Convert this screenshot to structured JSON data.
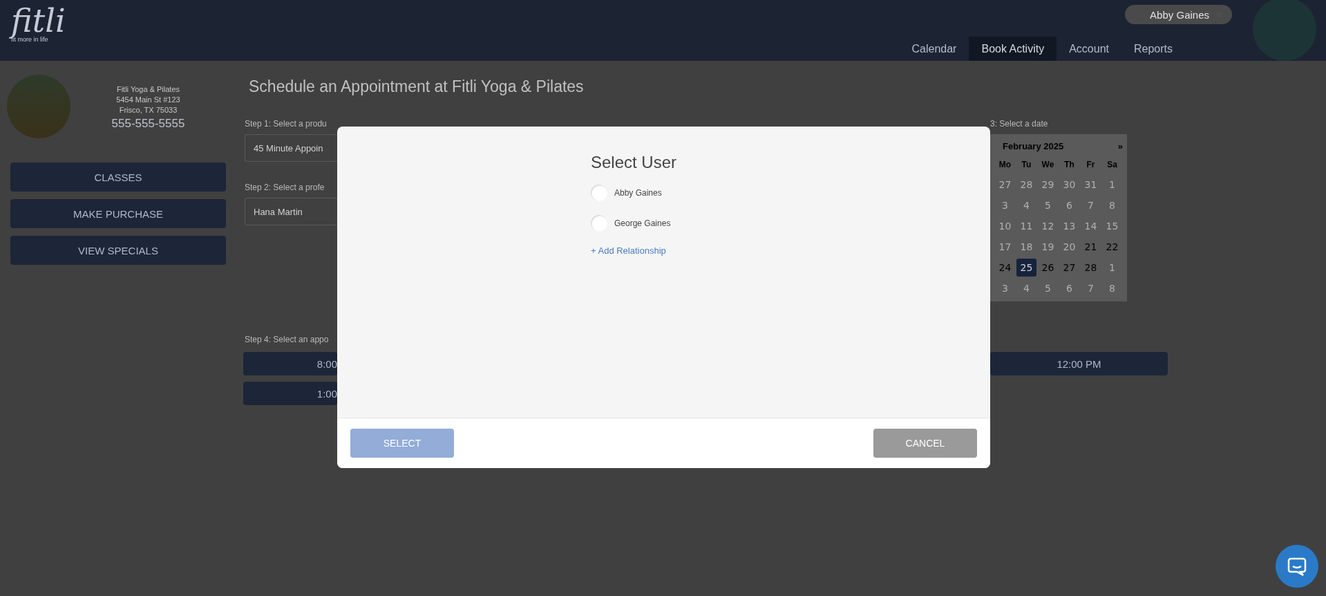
{
  "header": {
    "logo": "fitli",
    "tagline": "fit more in life",
    "user_menu": "Abby Gaines",
    "nav": [
      {
        "label": "Calendar",
        "selected": false
      },
      {
        "label": "Book Activity",
        "selected": true
      },
      {
        "label": "Account",
        "selected": false
      },
      {
        "label": "Reports",
        "selected": false
      }
    ]
  },
  "sidebar": {
    "studio_name": "Fitli Yoga & Pilates",
    "address_line_1": "5454 Main St #123",
    "address_line_2": "Frisco, TX 75033",
    "phone": "555-555-5555",
    "buttons": [
      "CLASSES",
      "MAKE PURCHASE",
      "VIEW SPECIALS"
    ]
  },
  "main": {
    "title": "Schedule an Appointment at Fitli Yoga & Pilates",
    "step_1": {
      "label": "Step 1: Select a produ",
      "value": "45 Minute Appoin"
    },
    "step_2": {
      "label": "Step 2: Select a profe",
      "value": "Hana Martin"
    },
    "step_3": {
      "label": "3: Select a date",
      "calendar": {
        "month": "February 2025",
        "next": "»",
        "weekdays": [
          "Mo",
          "Tu",
          "We",
          "Th",
          "Fr",
          "Sa"
        ],
        "weeks": [
          [
            {
              "label": "27",
              "available": false,
              "selected": false
            },
            {
              "label": "28",
              "available": false,
              "selected": false
            },
            {
              "label": "29",
              "available": false,
              "selected": false
            },
            {
              "label": "30",
              "available": false,
              "selected": false
            },
            {
              "label": "31",
              "available": false,
              "selected": false
            },
            {
              "label": "1",
              "available": false,
              "selected": false
            }
          ],
          [
            {
              "label": "3",
              "available": false,
              "selected": false
            },
            {
              "label": "4",
              "available": false,
              "selected": false
            },
            {
              "label": "5",
              "available": false,
              "selected": false
            },
            {
              "label": "6",
              "available": false,
              "selected": false
            },
            {
              "label": "7",
              "available": false,
              "selected": false
            },
            {
              "label": "8",
              "available": false,
              "selected": false
            }
          ],
          [
            {
              "label": "10",
              "available": false,
              "selected": false
            },
            {
              "label": "11",
              "available": false,
              "selected": false
            },
            {
              "label": "12",
              "available": false,
              "selected": false
            },
            {
              "label": "13",
              "available": false,
              "selected": false
            },
            {
              "label": "14",
              "available": false,
              "selected": false
            },
            {
              "label": "15",
              "available": false,
              "selected": false
            }
          ],
          [
            {
              "label": "17",
              "available": false,
              "selected": false
            },
            {
              "label": "18",
              "available": false,
              "selected": false
            },
            {
              "label": "19",
              "available": false,
              "selected": false
            },
            {
              "label": "20",
              "available": false,
              "selected": false
            },
            {
              "label": "21",
              "available": true,
              "selected": false
            },
            {
              "label": "22",
              "available": true,
              "selected": false
            }
          ],
          [
            {
              "label": "24",
              "available": true,
              "selected": false
            },
            {
              "label": "25",
              "available": true,
              "selected": true
            },
            {
              "label": "26",
              "available": true,
              "selected": false
            },
            {
              "label": "27",
              "available": true,
              "selected": false
            },
            {
              "label": "28",
              "available": true,
              "selected": false
            },
            {
              "label": "1",
              "available": false,
              "selected": false
            }
          ],
          [
            {
              "label": "3",
              "available": false,
              "selected": false
            },
            {
              "label": "4",
              "available": false,
              "selected": false
            },
            {
              "label": "5",
              "available": false,
              "selected": false
            },
            {
              "label": "6",
              "available": false,
              "selected": false
            },
            {
              "label": "7",
              "available": false,
              "selected": false
            },
            {
              "label": "8",
              "available": false,
              "selected": false
            }
          ]
        ]
      }
    },
    "step_4": {
      "label": "Step 4: Select an appo",
      "times": [
        {
          "left": "8:00",
          "right": "12:00 PM"
        },
        {
          "left": "1:00"
        }
      ]
    }
  },
  "modal": {
    "title": "Select User",
    "users": [
      {
        "name": "Abby Gaines",
        "selected": false
      },
      {
        "name": "George Gaines",
        "selected": false
      }
    ],
    "add_link": "+ Add Relationship",
    "select_button": {
      "label": "SELECT",
      "disabled": true
    },
    "cancel_button": "CANCEL"
  }
}
